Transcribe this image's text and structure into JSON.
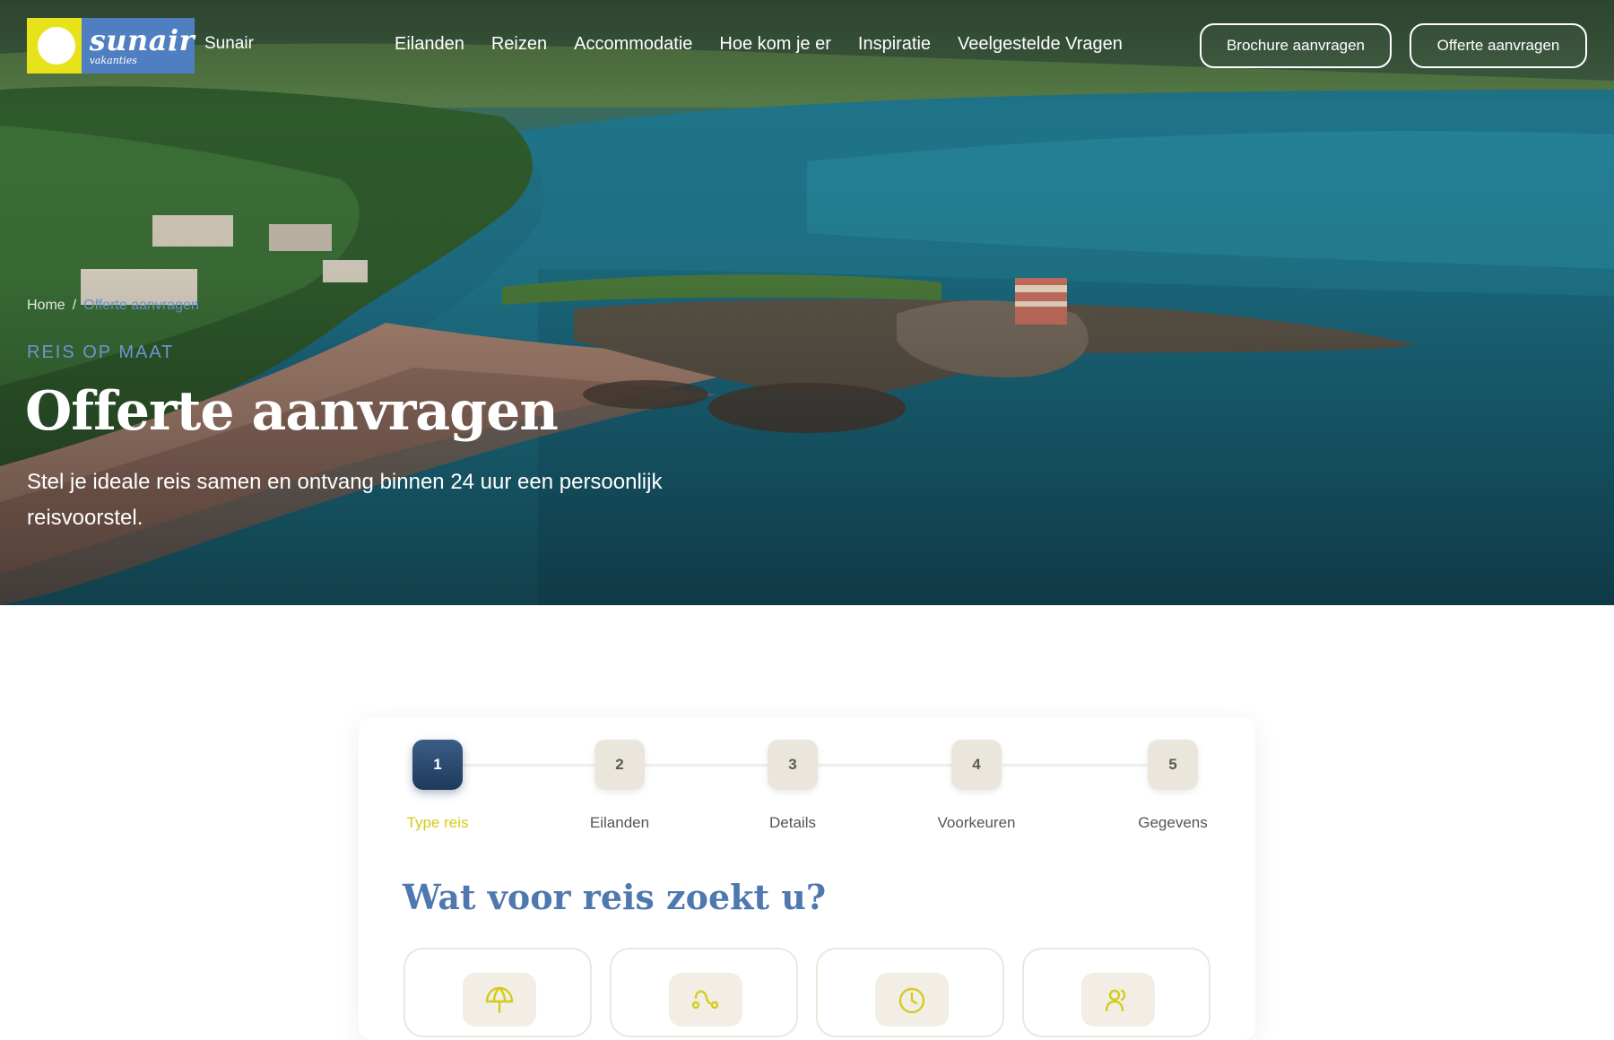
{
  "header": {
    "logo": {
      "word": "sunair",
      "tagline": "vakanties"
    },
    "brand_name": "Sunair",
    "nav": [
      "Eilanden",
      "Reizen",
      "Accommodatie",
      "Hoe kom je er",
      "Inspiratie",
      "Veelgestelde Vragen"
    ],
    "brochure_button": "Brochure aanvragen",
    "offerte_button": "Offerte aanvragen"
  },
  "hero": {
    "breadcrumb": {
      "home": "Home",
      "separator": "/",
      "current": "Offerte aanvragen"
    },
    "eyebrow": "REIS OP MAAT",
    "title": "Offerte aanvragen",
    "subtitle": "Stel je ideale reis samen en ontvang binnen 24 uur een persoonlijk reisvoorstel."
  },
  "form": {
    "steps": [
      {
        "number": "1",
        "label": "Type reis",
        "active": true
      },
      {
        "number": "2",
        "label": "Eilanden",
        "active": false
      },
      {
        "number": "3",
        "label": "Details",
        "active": false
      },
      {
        "number": "4",
        "label": "Voorkeuren",
        "active": false
      },
      {
        "number": "5",
        "label": "Gegevens",
        "active": false
      }
    ],
    "title": "Wat voor reis zoekt u?",
    "options": [
      {
        "icon": "umbrella-icon"
      },
      {
        "icon": "route-icon"
      },
      {
        "icon": "clock-icon"
      },
      {
        "icon": "users-icon"
      }
    ]
  },
  "colors": {
    "logo_blue": "#4f7fc0",
    "logo_yellow": "#e8e21a",
    "active_step": "#1f3a5c",
    "active_label": "#d4cc1a",
    "heading_blue": "#4f78b0",
    "eyebrow_blue": "#6f95cf"
  }
}
